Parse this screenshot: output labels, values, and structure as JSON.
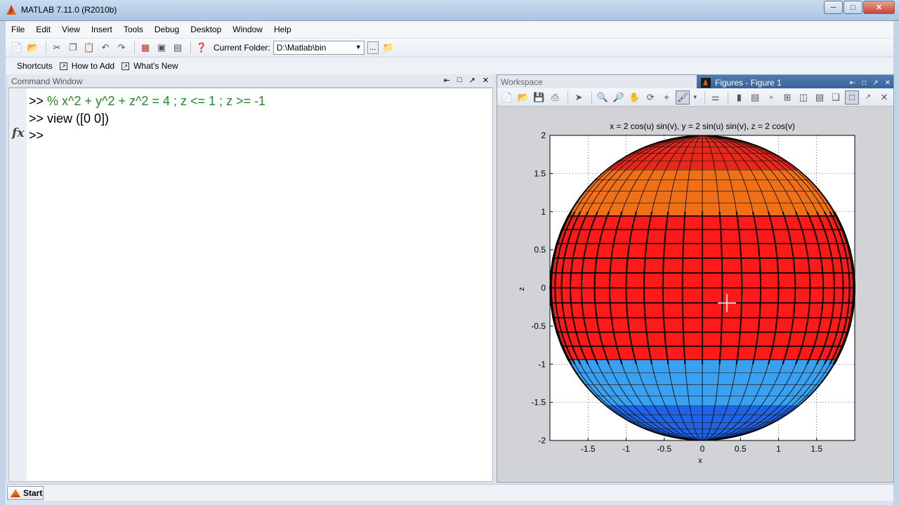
{
  "app": {
    "title": "MATLAB  7.11.0 (R2010b)"
  },
  "menu": [
    "File",
    "Edit",
    "View",
    "Insert",
    "Tools",
    "Debug",
    "Desktop",
    "Window",
    "Help"
  ],
  "toolbar": {
    "current_folder_label": "Current Folder:",
    "current_folder_value": "D:\\Matlab\\bin",
    "browse_label": "..."
  },
  "shortcuts": {
    "shortcuts_label": "Shortcuts",
    "how_to_add": "How to Add",
    "whats_new": "What's New"
  },
  "command_window": {
    "title": "Command Window",
    "lines": [
      {
        "prompt": ">> ",
        "text": "% x^2 + y^2 + z^2 = 4 ; z <= 1 ; z >= -1",
        "style": "comment"
      },
      {
        "prompt": ">> ",
        "text": "view ([0 0])",
        "style": "normal"
      },
      {
        "prompt": ">>",
        "text": "",
        "style": "normal"
      }
    ],
    "fx_label": "fx"
  },
  "panel": {
    "workspace_tab": "Workspace",
    "figure_tab": "Figures - Figure 1"
  },
  "chart_data": {
    "type": "surface",
    "title": "x = 2 cos(u) sin(v), y = 2 sin(u) sin(v), z = 2 cos(v)",
    "xlabel": "x",
    "ylabel": "z",
    "xlim": [
      -2,
      2
    ],
    "ylim": [
      -2,
      2
    ],
    "xticks": [
      -1.5,
      -1,
      -0.5,
      0,
      0.5,
      1,
      1.5
    ],
    "yticks": [
      2,
      1.5,
      1,
      0.5,
      0,
      -0.5,
      -1,
      -1.5,
      -2
    ],
    "x_tick_labels": [
      "-1.5",
      "-1",
      "-0.5",
      "0",
      "0.5",
      "1",
      "1.5"
    ],
    "y_tick_labels": [
      "2",
      "1.5",
      "1",
      "0.5",
      "0",
      "-0.5",
      "-1",
      "-1.5",
      "-2"
    ],
    "sphere_radius": 2,
    "highlighted_band": {
      "zmin": -1,
      "zmax": 1
    },
    "grid": true,
    "view": "[0 0]",
    "colors": {
      "band": "#ff1a1a",
      "top_red": "#e8281a",
      "top_orange": "#f07018",
      "bottom_blue": "#1e64e6",
      "bottom_lightblue": "#3aa0f0"
    }
  },
  "statusbar": {
    "start_label": "Start"
  }
}
